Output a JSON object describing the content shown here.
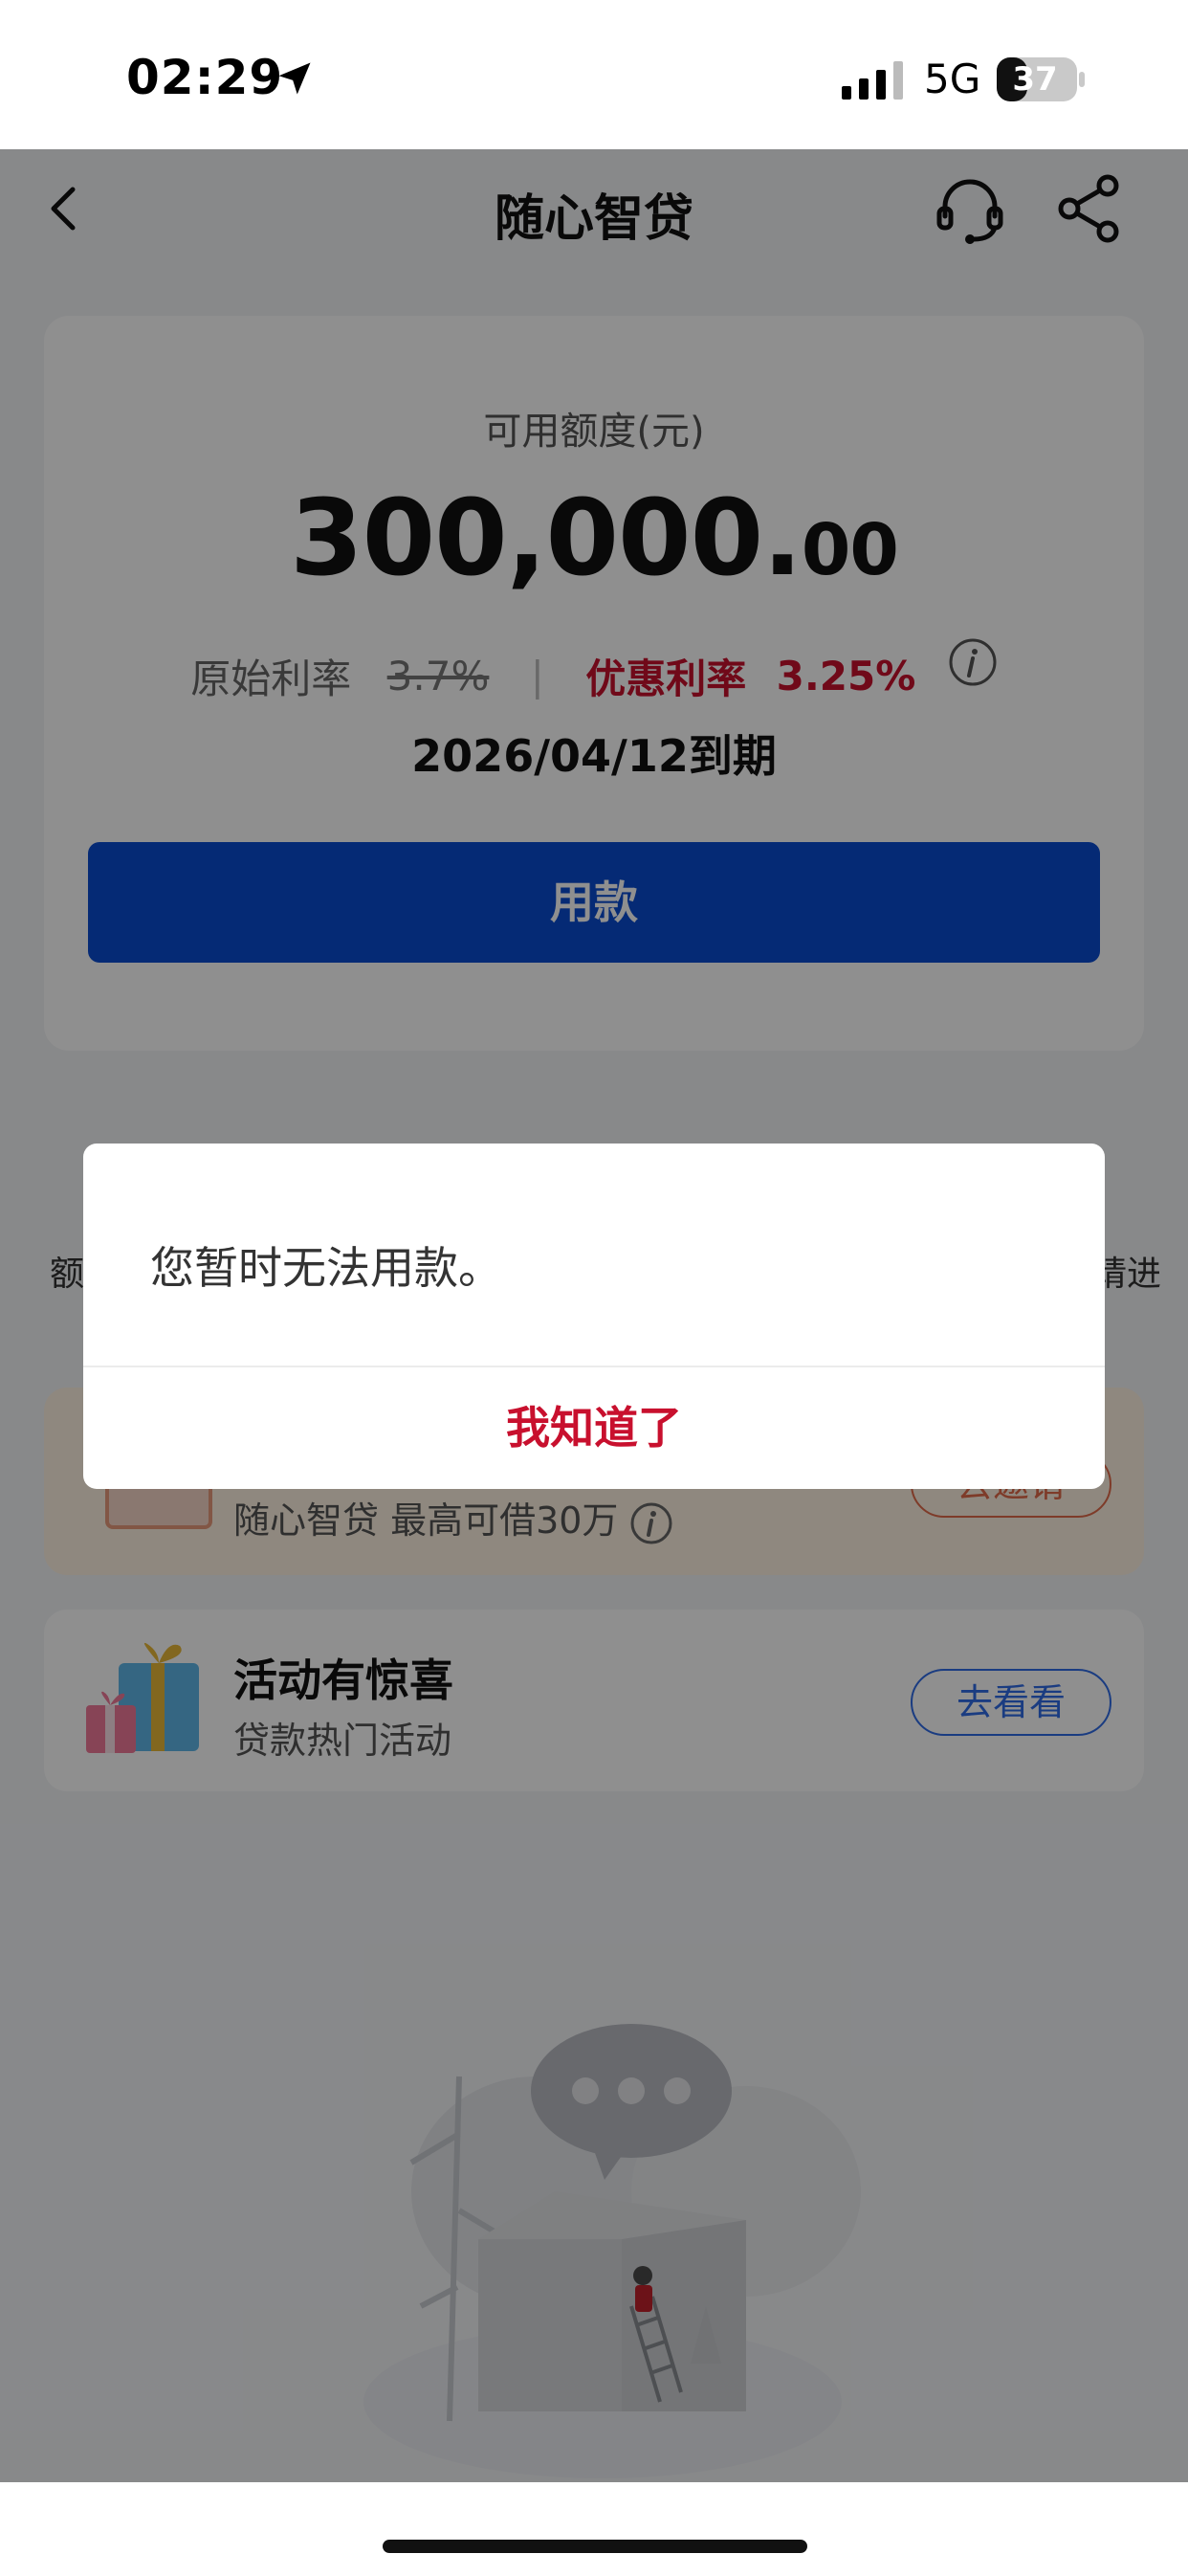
{
  "status_bar": {
    "time": "02:29",
    "network": "5G",
    "battery": "37",
    "icons": [
      "location-arrow-icon",
      "signal-icon",
      "battery-icon"
    ]
  },
  "nav": {
    "title": "随心智贷",
    "icons": [
      "back-icon",
      "customer-service-icon",
      "share-icon"
    ]
  },
  "credit_card": {
    "label": "可用额度(元)",
    "amount_main": "300,000.",
    "amount_decimal": "00",
    "original_rate_label": "原始利率",
    "original_rate": "3.7%",
    "divider": "|",
    "promo_rate_label": "优惠利率",
    "promo_rate": "3.25%",
    "expiry": "2026/04/12到期",
    "use_button": "用款"
  },
  "tips": {
    "left_fragment": "额",
    "right_fragment": "请进"
  },
  "invite": {
    "subtitle": "随心智贷 最高可借30万",
    "button": "去邀请"
  },
  "activity": {
    "title": "活动有惊喜",
    "subtitle": "贷款热门活动",
    "button": "去看看"
  },
  "dialog": {
    "message": "您暂时无法用款。",
    "confirm": "我知道了"
  },
  "colors": {
    "primary_blue": "#0a4bd1",
    "accent_red": "#c8102e",
    "invite_bg": "#fff3e3"
  }
}
